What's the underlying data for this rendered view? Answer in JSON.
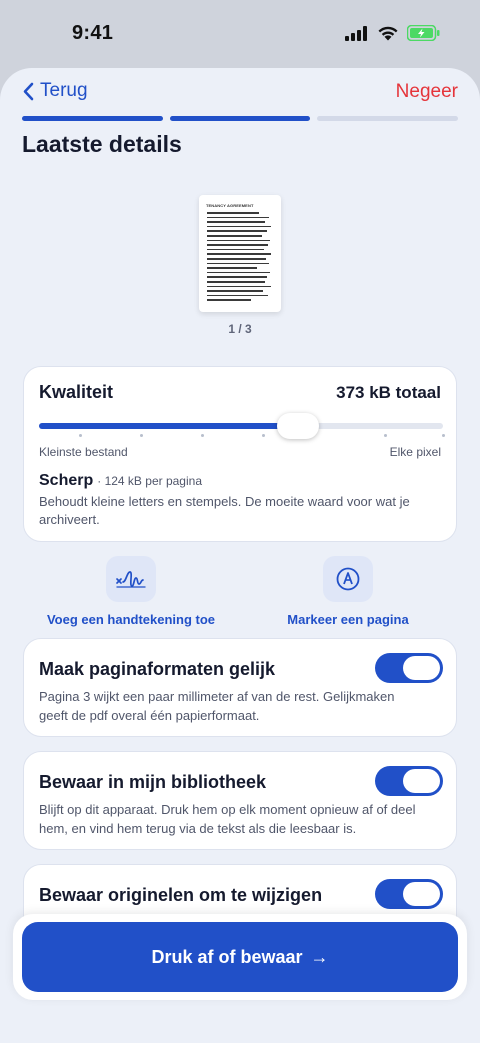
{
  "status_bar": {
    "time": "9:41"
  },
  "nav": {
    "back_label": "Terug",
    "skip_label": "Negeer"
  },
  "progress": {
    "total_steps": 3,
    "completed_steps": 2
  },
  "title": "Laatste details",
  "preview": {
    "doc_heading": "TENANCY AGREEMENT",
    "page_indicator": "1 / 3"
  },
  "quality": {
    "title": "Kwaliteit",
    "total": "373 kB totaal",
    "slider_position": 0.64,
    "min_label": "Kleinste bestand",
    "max_label": "Elke pixel",
    "level": "Scherp",
    "level_detail": "· 124 kB per pagina",
    "description": "Behoudt kleine letters en stempels. De moeite waard voor wat je archiveert."
  },
  "actions": [
    {
      "label": "Voeg een handtekening toe",
      "icon": "signature-icon"
    },
    {
      "label": "Markeer een pagina",
      "icon": "markup-pen-icon"
    }
  ],
  "toggles": [
    {
      "title": "Maak paginaformaten gelijk",
      "description": "Pagina 3 wijkt een paar millimeter af van de rest. Gelijkmaken geeft de pdf overal één papierformaat.",
      "on": true
    },
    {
      "title": "Bewaar in mijn bibliotheek",
      "description": "Blijft op dit apparaat. Druk hem op elk moment opnieuw af of deel hem, en vind hem terug via de tekst als die leesbaar is.",
      "on": true
    },
    {
      "title": "Bewaar originelen om te wijzigen",
      "description": "",
      "on": true
    }
  ],
  "cta": {
    "label": "Druk af of bewaar",
    "arrow": "→"
  },
  "colors": {
    "accent": "#2150c8",
    "destructive": "#e5343a",
    "background": "#ecf0f8",
    "battery": "#4cd964"
  }
}
